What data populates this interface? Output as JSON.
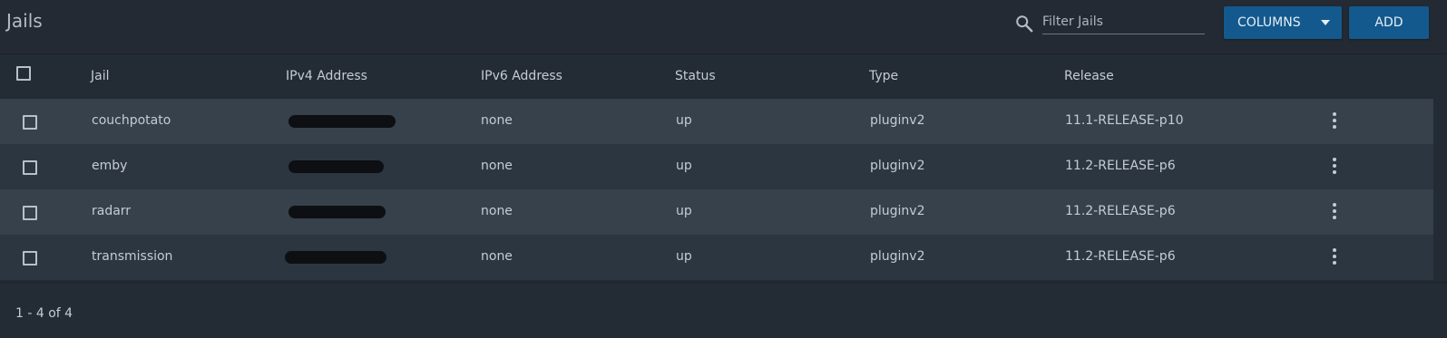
{
  "header": {
    "title": "Jails",
    "search_icon": "search-icon",
    "filter_placeholder": "Filter Jails",
    "filter_value": "",
    "columns_label": "COLUMNS",
    "add_label": "ADD"
  },
  "table": {
    "columns": [
      "Jail",
      "IPv4 Address",
      "IPv6 Address",
      "Status",
      "Type",
      "Release"
    ],
    "rows": [
      {
        "jail": "couchpotato",
        "ipv4": "",
        "ipv6": "none",
        "status": "up",
        "type": "pluginv2",
        "release": "11.1-RELEASE-p10"
      },
      {
        "jail": "emby",
        "ipv4": "",
        "ipv6": "none",
        "status": "up",
        "type": "pluginv2",
        "release": "11.2-RELEASE-p6"
      },
      {
        "jail": "radarr",
        "ipv4": "",
        "ipv6": "none",
        "status": "up",
        "type": "pluginv2",
        "release": "11.2-RELEASE-p6"
      },
      {
        "jail": "transmission",
        "ipv4": "",
        "ipv6": "none",
        "status": "up",
        "type": "pluginv2",
        "release": "11.2-RELEASE-p6"
      }
    ]
  },
  "footer": {
    "pagination": "1 - 4 of 4"
  }
}
